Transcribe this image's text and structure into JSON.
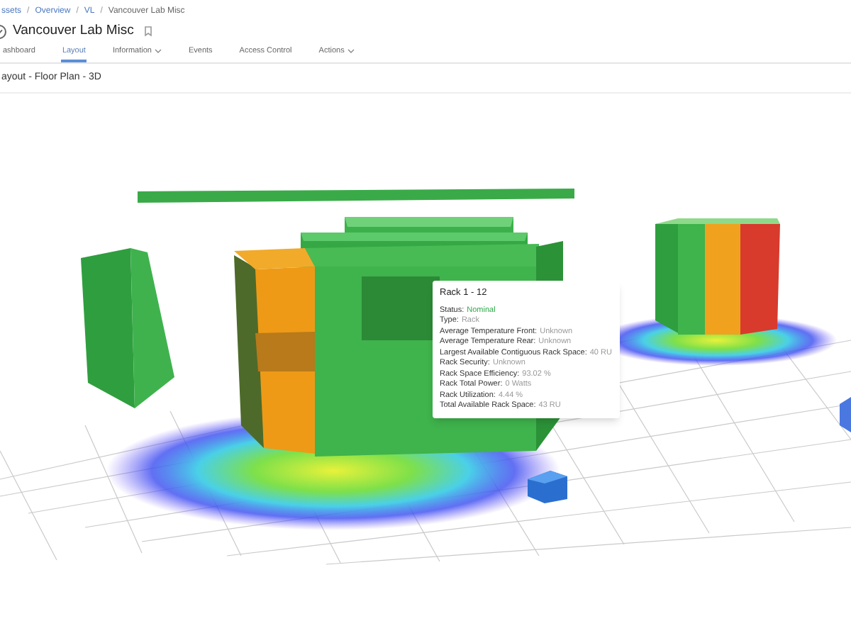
{
  "breadcrumb": [
    "ssets",
    "Overview",
    "VL",
    "Vancouver Lab Misc"
  ],
  "breadcrumb_separator": "/",
  "title": "Vancouver Lab Misc",
  "tabs": [
    {
      "label": "ashboard",
      "selected": false,
      "has_menu": false
    },
    {
      "label": "Layout",
      "selected": true,
      "has_menu": false
    },
    {
      "label": "Information",
      "selected": false,
      "has_menu": true
    },
    {
      "label": "Events",
      "selected": false,
      "has_menu": false
    },
    {
      "label": "Access Control",
      "selected": false,
      "has_menu": false
    },
    {
      "label": "Actions",
      "selected": false,
      "has_menu": true
    }
  ],
  "section_title": "ayout - Floor Plan - 3D",
  "tooltip": {
    "title": "Rack 1 - 12",
    "rows": [
      {
        "label": "Status:",
        "value": "Nominal",
        "kind": "status"
      },
      {
        "label": "Type:",
        "value": "Rack",
        "kind": "field"
      },
      {
        "label": "Average Temperature Front:",
        "value": "Unknown",
        "kind": "field"
      },
      {
        "label": "Average Temperature Rear:",
        "value": "Unknown",
        "kind": "field"
      },
      {
        "label": "Largest Available Contiguous Rack Space:",
        "value": "40 RU",
        "kind": "field"
      },
      {
        "label": "Rack Security:",
        "value": "Unknown",
        "kind": "field"
      },
      {
        "label": "Rack Space Efficiency:",
        "value": "93.02 %",
        "kind": "field"
      },
      {
        "label": "Rack Total Power:",
        "value": "0 Watts",
        "kind": "field"
      },
      {
        "label": "Rack Utilization:",
        "value": "4.44 %",
        "kind": "field"
      },
      {
        "label": "Total Available Rack Space:",
        "value": "43 RU",
        "kind": "field"
      }
    ]
  }
}
